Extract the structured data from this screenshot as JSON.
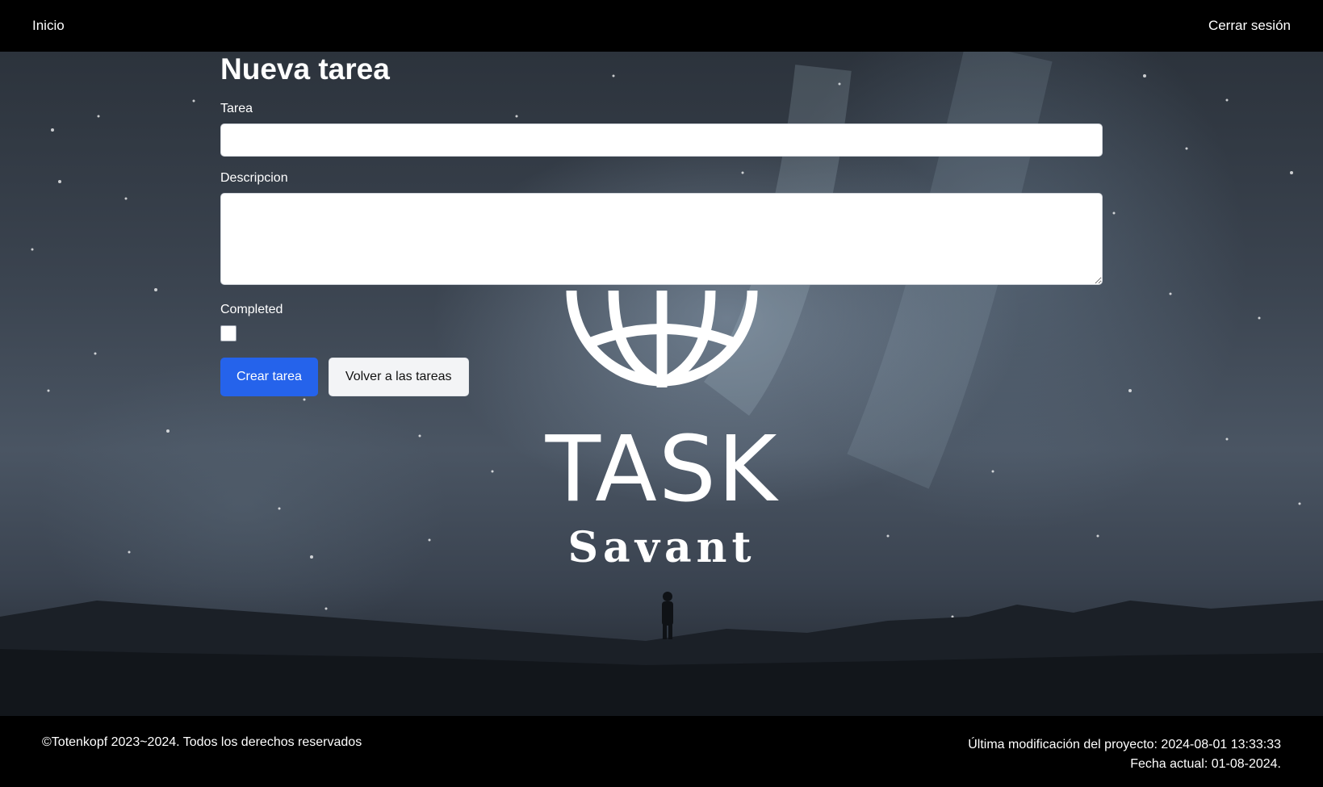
{
  "nav": {
    "home_label": "Inicio",
    "logout_label": "Cerrar sesión"
  },
  "form": {
    "title": "Nueva tarea",
    "task_label": "Tarea",
    "task_value": "",
    "description_label": "Descripcion",
    "description_value": "",
    "completed_label": "Completed",
    "completed_checked": false,
    "submit_label": "Crear tarea",
    "back_label": "Volver a las tareas"
  },
  "logo": {
    "line1": "TASK",
    "line2": "Savant"
  },
  "footer": {
    "copyright": "©Totenkopf 2023~2024. Todos los derechos reservados",
    "last_modified": "Última modificación del proyecto: 2024-08-01 13:33:33",
    "current_date": "Fecha actual: 01-08-2024."
  },
  "colors": {
    "primary": "#2563eb",
    "nav_bg": "#000000",
    "footer_bg": "#000000"
  }
}
